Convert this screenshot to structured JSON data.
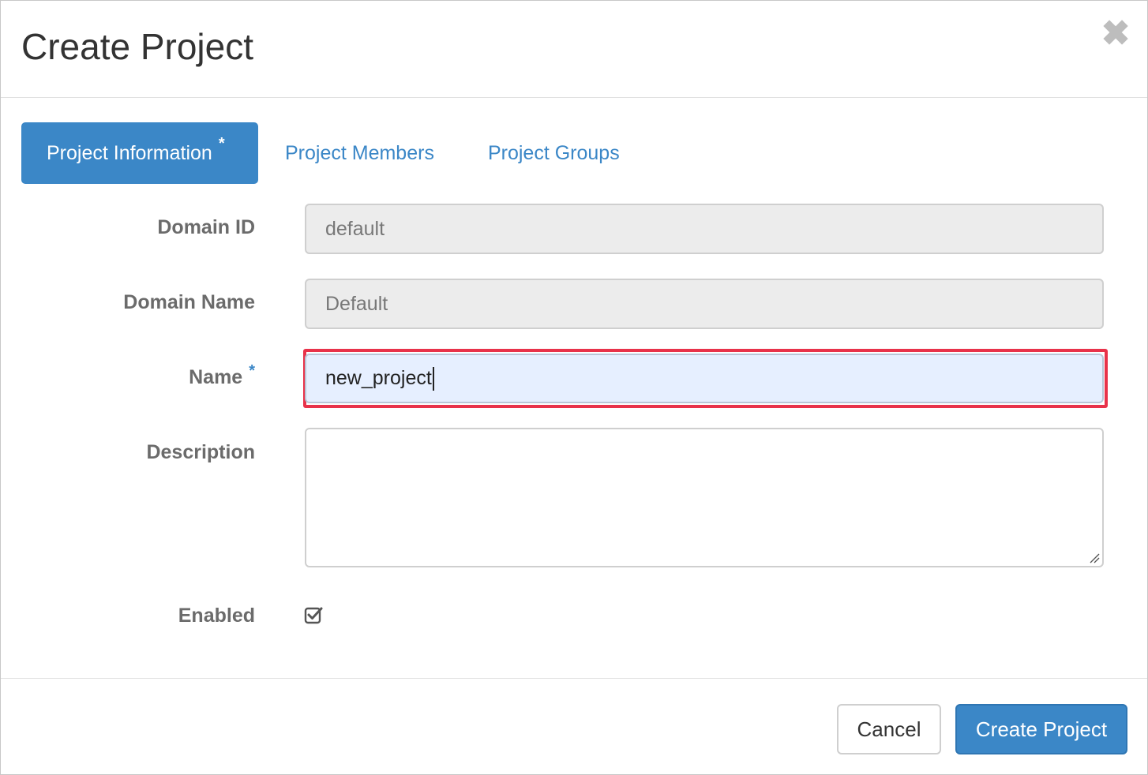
{
  "modal": {
    "title": "Create Project",
    "close_glyph": "✖"
  },
  "tabs": [
    {
      "label": "Project Information",
      "required_mark": "*",
      "active": true
    },
    {
      "label": "Project Members",
      "active": false
    },
    {
      "label": "Project Groups",
      "active": false
    }
  ],
  "form": {
    "domain_id": {
      "label": "Domain ID",
      "value": "default"
    },
    "domain_name": {
      "label": "Domain Name",
      "value": "Default"
    },
    "name": {
      "label": "Name",
      "required_mark": "*",
      "value": "new_project"
    },
    "description": {
      "label": "Description",
      "value": ""
    },
    "enabled": {
      "label": "Enabled",
      "checked": true
    }
  },
  "footer": {
    "cancel_label": "Cancel",
    "submit_label": "Create Project"
  },
  "colors": {
    "primary": "#3b87c7",
    "highlight_border": "#e8324a",
    "focused_input_bg": "#e6efff"
  },
  "icons": {
    "close": "close-icon",
    "checkbox": "checkbox-checked-icon",
    "resize": "resize-handle-icon"
  }
}
